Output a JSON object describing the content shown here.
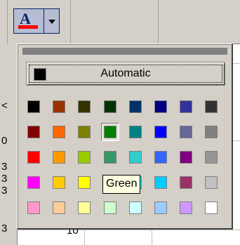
{
  "toolbar": {
    "font_color_letter": "A",
    "font_color_bar_color": "#ff0000",
    "font_color_icon": "font-color-icon",
    "dropdown_icon": "chevron-down-icon"
  },
  "sheet": {
    "row_headers": [
      "<",
      "0",
      "3",
      "3",
      "3",
      "3"
    ],
    "cell_value": "10"
  },
  "palette": {
    "automatic_label": "Automatic",
    "automatic_color": "#000000",
    "selected_color": "Green",
    "tooltip": "Green",
    "colors": [
      [
        "#000000",
        "#993300",
        "#333300",
        "#003300",
        "#003366",
        "#000080",
        "#333399",
        "#333333"
      ],
      [
        "#800000",
        "#ff6600",
        "#808000",
        "#008000",
        "#008080",
        "#0000ff",
        "#666699",
        "#808080"
      ],
      [
        "#ff0000",
        "#ff9900",
        "#99cc00",
        "#339966",
        "#33cccc",
        "#3366ff",
        "#800080",
        "#969696"
      ],
      [
        "#ff00ff",
        "#ffcc00",
        "#ffff00",
        "#00ff00",
        "#00ffff",
        "#00ccff",
        "#993366",
        "#c0c0c0"
      ],
      [
        "#ff99cc",
        "#ffcc99",
        "#ffff99",
        "#ccffcc",
        "#ccffff",
        "#99ccff",
        "#cc99ff",
        "#ffffff"
      ]
    ]
  }
}
